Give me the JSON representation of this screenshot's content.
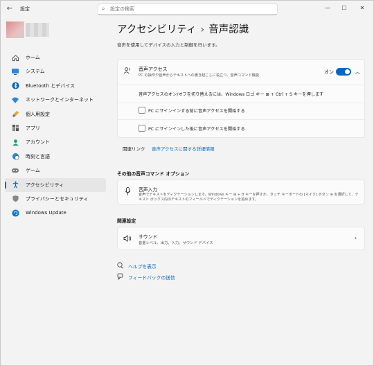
{
  "window": {
    "app_title": "設定",
    "minimize_label": "—",
    "maximize_label": "☐",
    "close_label": "✕",
    "back_label": "←"
  },
  "search": {
    "placeholder": "設定の検索"
  },
  "sidebar": {
    "items": [
      {
        "label": "ホーム",
        "icon": "home-icon"
      },
      {
        "label": "システム",
        "icon": "monitor-icon"
      },
      {
        "label": "Bluetooth とデバイス",
        "icon": "bluetooth-icon"
      },
      {
        "label": "ネットワークとインターネット",
        "icon": "wifi-icon"
      },
      {
        "label": "個人用設定",
        "icon": "brush-icon"
      },
      {
        "label": "アプリ",
        "icon": "apps-icon"
      },
      {
        "label": "アカウント",
        "icon": "person-icon"
      },
      {
        "label": "時刻と言語",
        "icon": "globe-clock-icon"
      },
      {
        "label": "ゲーム",
        "icon": "gamepad-icon"
      },
      {
        "label": "アクセシビリティ",
        "icon": "accessibility-icon",
        "active": true
      },
      {
        "label": "プライバシーとセキュリティ",
        "icon": "shield-icon"
      },
      {
        "label": "Windows Update",
        "icon": "update-icon"
      }
    ]
  },
  "header": {
    "breadcrumb_parent": "アクセシビリティ",
    "breadcrumb_sep": "›",
    "title": "音声認識",
    "description": "音声を使用してデバイスの入力と制御を行います。"
  },
  "voice_access": {
    "title": "音声アクセス",
    "subtitle": "PC の操作や音声からテキストへの書き起こしに役立つ、音声コマンド機能",
    "toggle_label": "オン",
    "toggle_on": true,
    "shortcut_text": "音声アクセスのオン/オフを切り替えるには、Windows ロゴ キー ⊞ + Ctrl + S キーを押します",
    "checkbox1": "PC にサインインする前に音声アクセスを開始する",
    "checkbox2": "PC にサインインした後に音声アクセスを開始する"
  },
  "related": {
    "label": "関連リンク",
    "link": "音声アクセスに関する詳細情報"
  },
  "other_commands": {
    "heading": "その他の音声コマンド オプション",
    "title": "音声入力",
    "subtitle": "音声でテキストをディクテーションします。Windows キー ⊞ + H キーを押すか、タッチ キーボードの [マイク] ボタン ⊕ を選択して、テキスト ボックス内のテキストのフィールドでディクテーションを始めます。"
  },
  "related_settings": {
    "heading": "関連設定",
    "sound_title": "サウンド",
    "sound_subtitle": "音量レベル、出力、入力、サウンド デバイス"
  },
  "help": {
    "get_help": "ヘルプを表示",
    "feedback": "フィードバックの送信"
  },
  "colors": {
    "accent": "#0067c0"
  }
}
